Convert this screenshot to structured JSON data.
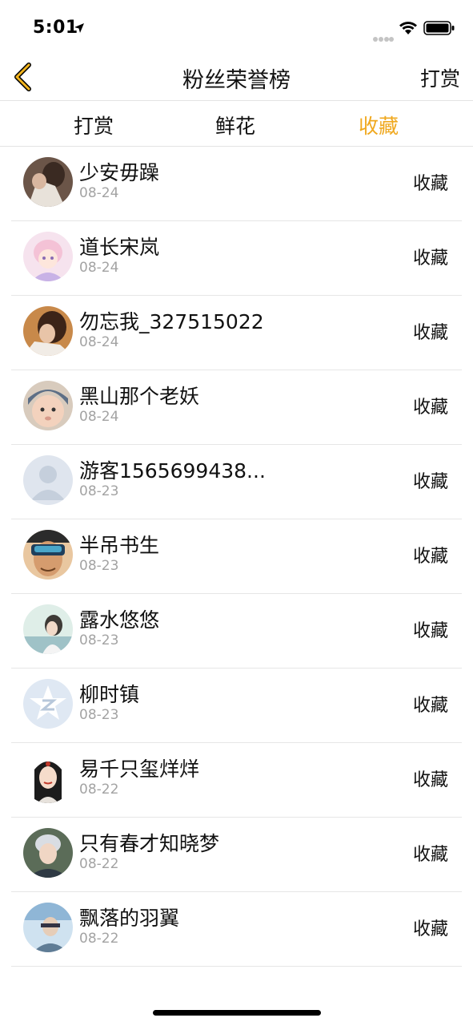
{
  "status_bar": {
    "time": "5:01"
  },
  "nav": {
    "title": "粉丝荣誉榜",
    "action": "打赏"
  },
  "tabs": [
    {
      "label": "打赏",
      "active": false
    },
    {
      "label": "鲜花",
      "active": false
    },
    {
      "label": "收藏",
      "active": true
    }
  ],
  "colors": {
    "accent": "#f0a81e",
    "text": "#111111",
    "date": "#a3a3a3"
  },
  "fans": [
    {
      "name": "少安毋躁",
      "date": "08-24",
      "action": "收藏"
    },
    {
      "name": "道长宋岚",
      "date": "08-24",
      "action": "收藏"
    },
    {
      "name": "勿忘我_327515022",
      "date": "08-24",
      "action": "收藏"
    },
    {
      "name": "黑山那个老妖",
      "date": "08-24",
      "action": "收藏"
    },
    {
      "name": "游客1565699438...",
      "date": "08-23",
      "action": "收藏"
    },
    {
      "name": "半吊书生",
      "date": "08-23",
      "action": "收藏"
    },
    {
      "name": "露水悠悠",
      "date": "08-23",
      "action": "收藏"
    },
    {
      "name": "柳时镇",
      "date": "08-23",
      "action": "收藏"
    },
    {
      "name": "易千只玺烊烊",
      "date": "08-22",
      "action": "收藏"
    },
    {
      "name": "只有春才知晓梦",
      "date": "08-22",
      "action": "收藏"
    },
    {
      "name": "飘落的羽翼",
      "date": "08-22",
      "action": "收藏"
    }
  ]
}
